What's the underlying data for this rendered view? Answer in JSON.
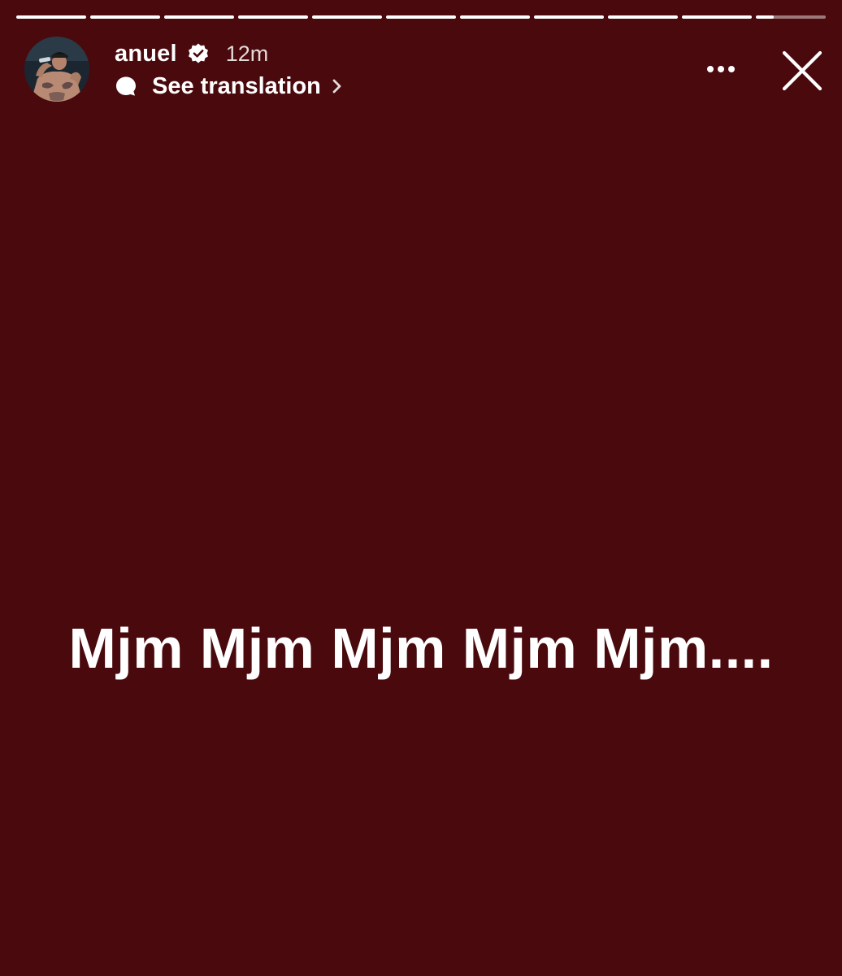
{
  "theme": {
    "background": "#4a0a0d",
    "foreground": "#ffffff"
  },
  "progress": {
    "segments": 11,
    "completed": 10,
    "current_fraction": 0.25
  },
  "header": {
    "username": "anuel",
    "verified": true,
    "timestamp": "12m",
    "translate_label": "See translation",
    "icons": {
      "avatar": "profile-photo",
      "verified": "verified-badge-icon",
      "translate": "speech-bubble-icon",
      "chevron": "chevron-right-icon",
      "more": "more-dots-icon",
      "close": "close-icon"
    }
  },
  "story": {
    "text": "Mjm Mjm Mjm Mjm Mjm...."
  }
}
